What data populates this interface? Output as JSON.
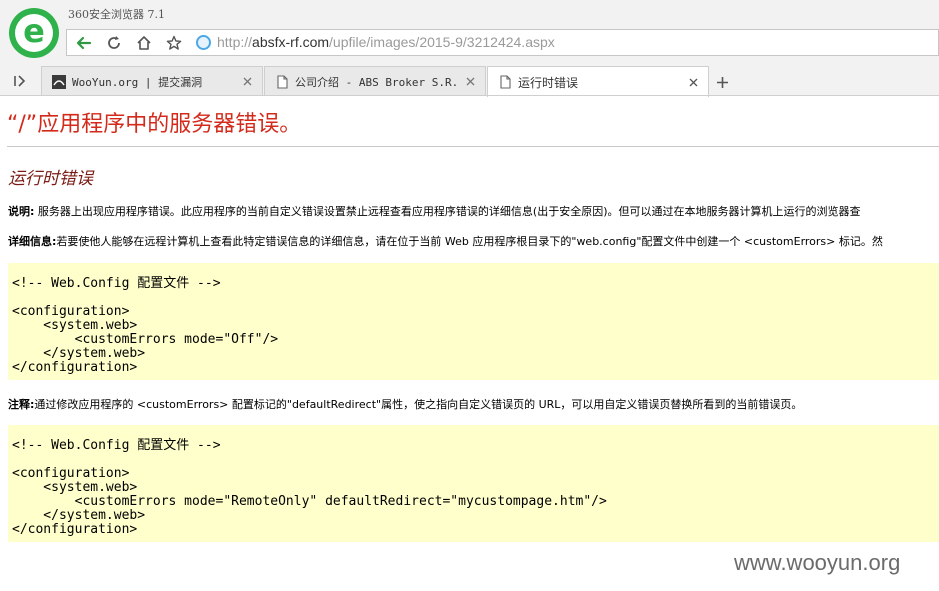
{
  "window": {
    "app_title": "360安全浏览器 7.1"
  },
  "address_bar": {
    "url_prefix": "http://",
    "url_host": "absfx-rf.com",
    "url_path": "/upfile/images/2015-9/3212424.aspx"
  },
  "tabs": [
    {
      "label": "WooYun.org | 提交漏洞",
      "icon": "wooyun-favicon",
      "active": false
    },
    {
      "label": "公司介绍 - ABS Broker S.R.L",
      "icon": "page-icon",
      "active": false
    },
    {
      "label": "运行时错误",
      "icon": "page-icon",
      "active": true
    }
  ],
  "page": {
    "heading": "“/”应用程序中的服务器错误。",
    "subheading": "运行时错误",
    "description_label": "说明:",
    "description_text": "服务器上出现应用程序错误。此应用程序的当前自定义错误设置禁止远程查看应用程序错误的详细信息(出于安全原因)。但可以通过在本地服务器计算机上运行的浏览器查",
    "details_label": "详细信息:",
    "details_text": "若要使他人能够在远程计算机上查看此特定错误信息的详细信息，请在位于当前 Web 应用程序根目录下的\"web.config\"配置文件中创建一个 <customErrors> 标记。然",
    "code1": [
      "<!-- Web.Config 配置文件 -->",
      "",
      "<configuration>",
      "    <system.web>",
      "        <customErrors mode=\"Off\"/>",
      "    </system.web>",
      "</configuration>"
    ],
    "note_label": "注释:",
    "note_text": "通过修改应用程序的 <customErrors> 配置标记的\"defaultRedirect\"属性，使之指向自定义错误页的 URL，可以用自定义错误页替换所看到的当前错误页。",
    "code2": [
      "<!-- Web.Config 配置文件 -->",
      "",
      "<configuration>",
      "    <system.web>",
      "        <customErrors mode=\"RemoteOnly\" defaultRedirect=\"mycustompage.htm\"/>",
      "    </system.web>",
      "</configuration>"
    ]
  },
  "watermark": "www.wooyun.org",
  "colors": {
    "brand_green": "#2fb24c",
    "error_red": "#d42a1c",
    "code_bg": "#ffffcc"
  }
}
